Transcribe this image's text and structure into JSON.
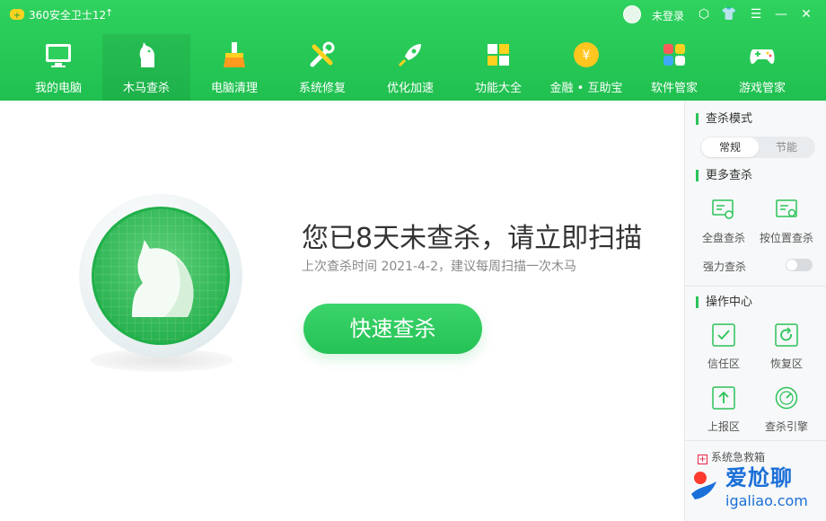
{
  "app": {
    "title": "360安全卫士12"
  },
  "user": {
    "login": "未登录"
  },
  "nav": [
    {
      "label": "我的电脑",
      "icon": "monitor-icon"
    },
    {
      "label": "木马查杀",
      "icon": "horse-icon"
    },
    {
      "label": "电脑清理",
      "icon": "broom-icon"
    },
    {
      "label": "系统修复",
      "icon": "tools-icon"
    },
    {
      "label": "优化加速",
      "icon": "rocket-icon"
    },
    {
      "label": "功能大全",
      "icon": "grid-icon"
    },
    {
      "label": "金融 • 互助宝",
      "icon": "coin-icon"
    },
    {
      "label": "软件管家",
      "icon": "apps-icon"
    },
    {
      "label": "游戏管家",
      "icon": "gamepad-icon"
    }
  ],
  "main": {
    "headline": "您已8天未查杀，请立即扫描",
    "subline": "上次查杀时间 2021-4-2，建议每周扫描一次木马",
    "scan_button": "快速查杀"
  },
  "side": {
    "mode_title": "查杀模式",
    "mode_options": [
      "常规",
      "节能"
    ],
    "more_title": "更多查杀",
    "full_scan": "全盘查杀",
    "location_scan": "按位置查杀",
    "force_scan": "强力查杀",
    "ops_title": "操作中心",
    "trust_zone": "信任区",
    "restore_zone": "恢复区",
    "report_zone": "上报区",
    "engine": "查杀引擎",
    "emergency": "系统急救箱"
  },
  "watermark": {
    "brand": "爱尬聊",
    "url": "igaliao.com"
  },
  "colors": {
    "accent": "#25c256",
    "header": "#2ac358",
    "link": "#1a6fd8"
  }
}
